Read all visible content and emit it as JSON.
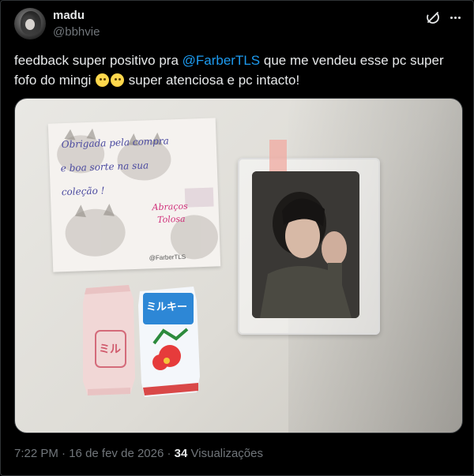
{
  "author": {
    "display_name": "madu",
    "handle": "@bbhvie"
  },
  "tweet": {
    "text_before_mention": "feedback super positivo pra ",
    "mention": "@FarberTLS",
    "text_after_mention": " que me vendeu esse pc super fofo do mingi ",
    "text_end": " super atenciosa e pc intacto!",
    "emoji_name": "pleading-face-emoji"
  },
  "image": {
    "note_lines": [
      "Obrigada pela compra",
      "e boa sorte na sua",
      "coleção !"
    ],
    "note_signature": [
      "Abraços",
      "Tolosa"
    ],
    "note_credit": "@FarberTLS",
    "candy_label": "ミルキー"
  },
  "meta": {
    "time": "7:22 PM",
    "separator": "·",
    "date": "16 de fev de 2026",
    "views_count": "34",
    "views_label": "Visualizações"
  },
  "icons": {
    "grok": "grok-icon",
    "more": "more-horizontal-icon"
  },
  "colors": {
    "background": "#000000",
    "text_primary": "#e7e9ea",
    "text_secondary": "#71767b",
    "link": "#1d9bf0"
  }
}
